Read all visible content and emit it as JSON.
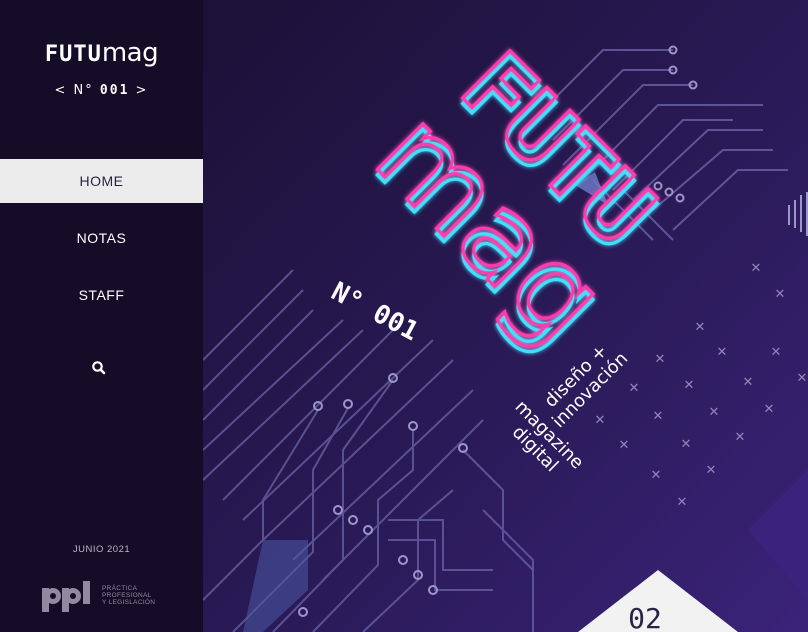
{
  "sidebar": {
    "logo": {
      "bold": "FUTU",
      "thin": "mag",
      "name": "FUTUmag"
    },
    "issue": {
      "prefix": "< N°",
      "number": "001",
      "suffix": ">"
    },
    "nav": [
      {
        "label": "HOME",
        "active": true
      },
      {
        "label": "NOTAS",
        "active": false
      },
      {
        "label": "STAFF",
        "active": false
      }
    ],
    "search_icon": "search-icon",
    "date": "JUNIO 2021",
    "publisher": {
      "logo": "ppl",
      "lines": [
        "PRÁCTICA",
        "PROFESIONAL",
        "Y LEGISLACIÓN"
      ]
    }
  },
  "cover": {
    "title_top": "FUTU",
    "title_bottom": "mag",
    "issue": "N° 001",
    "tagline": [
      "diseño +",
      "innovación"
    ],
    "subtitle": [
      "magazine",
      "digital"
    ],
    "page": "02"
  },
  "colors": {
    "sidebar_bg": "#150c27",
    "cover_bg": "#241649",
    "neon_pink": "#ff3bb0",
    "neon_cyan": "#3fe0ff",
    "active_tab": "#ececec"
  }
}
